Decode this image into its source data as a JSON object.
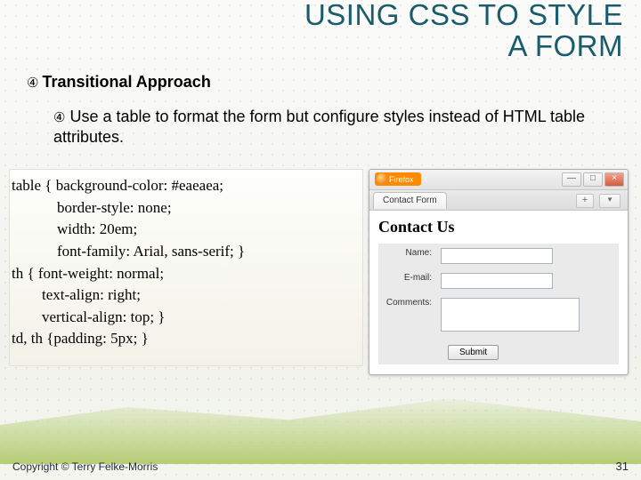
{
  "slide": {
    "title": "USING CSS TO STYLE A FORM",
    "heading_number": "④",
    "heading": "Transitional Approach",
    "bullet_number": "④",
    "bullet": "Use a table to format the form but configure styles instead of HTML table attributes.",
    "copyright": "Copyright © Terry Felke-Morris",
    "page_number": "31"
  },
  "code": {
    "l1": "table { background-color: #eaeaea;",
    "l2": "            border-style: none;",
    "l3": "            width: 20em;",
    "l4": "            font-family: Arial, sans-serif; }",
    "l5": "th { font-weight: normal;",
    "l6": "        text-align: right;",
    "l7": "        vertical-align: top; }",
    "l8": "td, th {padding: 5px; }"
  },
  "browser": {
    "app": "Firefox",
    "tab": "Contact Form",
    "min": "—",
    "max": "□",
    "close": "×",
    "newtab": "+",
    "tabdd": "▾",
    "page_title": "Contact Us",
    "labels": {
      "name": "Name:",
      "email": "E-mail:",
      "comments": "Comments:"
    },
    "submit": "Submit"
  }
}
